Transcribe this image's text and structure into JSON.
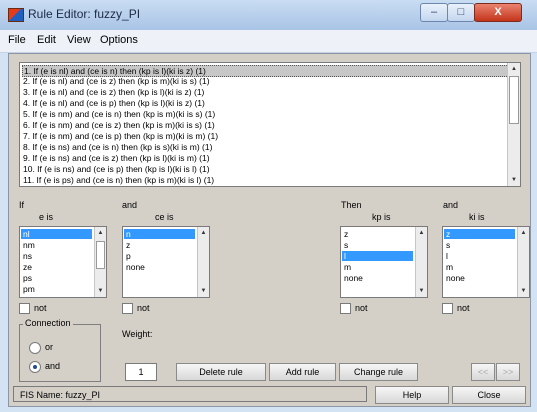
{
  "window": {
    "title": "Rule Editor: fuzzy_PI",
    "minimize_glyph": "–",
    "maximize_glyph": "□",
    "close_glyph": "X"
  },
  "menu": {
    "file": "File",
    "edit": "Edit",
    "view": "View",
    "options": "Options"
  },
  "rules": [
    "1. If (e is nl) and (ce is n) then (kp is l)(ki is z) (1)",
    "2. If (e is nl) and (ce is z) then (kp is m)(ki is s) (1)",
    "3. If (e is nl) and (ce is z) then (kp is l)(ki is z) (1)",
    "4. If (e is nl) and (ce is p) then (kp is l)(ki is z) (1)",
    "5. If (e is nm) and (ce is n) then (kp is m)(ki is s) (1)",
    "6. If (e is nm) and (ce is z) then (kp is m)(ki is s) (1)",
    "7. If (e is nm) and (ce is p) then (kp is m)(ki is m) (1)",
    "8. If (e is ns) and (ce is n) then (kp is s)(ki is m) (1)",
    "9. If (e is ns) and (ce is z) then (kp is l)(ki is m) (1)",
    "10. If (e is ns) and (ce is p) then (kp is l)(ki is l) (1)",
    "11. If (e is ps) and (ce is n) then (kp is m)(ki is l) (1)"
  ],
  "headers": {
    "if": "If",
    "and1": "and",
    "then": "Then",
    "and2": "and"
  },
  "inputs": {
    "e": {
      "label": "e is",
      "options": [
        "nl",
        "nm",
        "ns",
        "ze",
        "ps",
        "pm"
      ],
      "selected": "nl"
    },
    "ce": {
      "label": "ce is",
      "options": [
        "n",
        "z",
        "p",
        "none"
      ],
      "selected": "n"
    }
  },
  "outputs": {
    "kp": {
      "label": "kp is",
      "options": [
        "z",
        "s",
        "l",
        "m",
        "none"
      ],
      "selected": "l"
    },
    "ki": {
      "label": "ki is",
      "options": [
        "z",
        "s",
        "l",
        "m",
        "none"
      ],
      "selected": "z"
    }
  },
  "not_label": "not",
  "connection": {
    "title": "Connection",
    "or": "or",
    "and": "and",
    "selected": "and"
  },
  "weight": {
    "label": "Weight:",
    "value": "1"
  },
  "buttons": {
    "delete_rule": "Delete rule",
    "add_rule": "Add rule",
    "change_rule": "Change rule",
    "prev": "<<",
    "next": ">>",
    "help": "Help",
    "close": "Close"
  },
  "status": "FIS Name: fuzzy_PI"
}
